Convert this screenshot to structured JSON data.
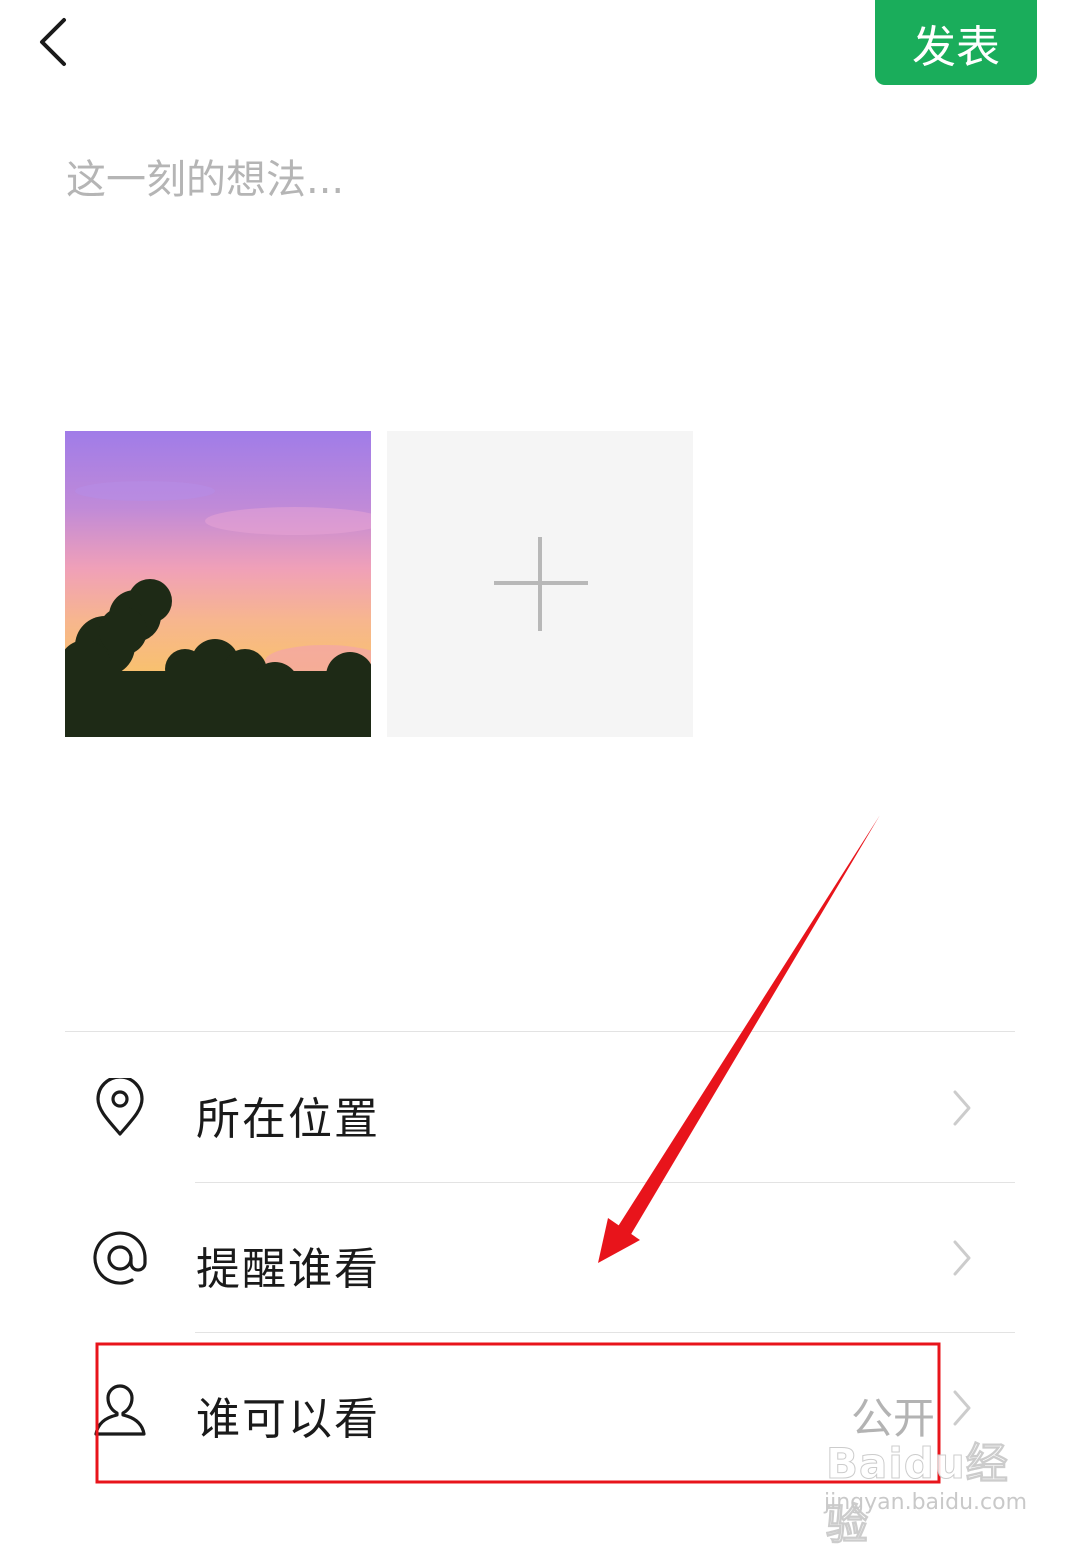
{
  "header": {
    "back_icon": "chevron-left-icon",
    "publish_label": "发表",
    "publish_color": "#1aad5b"
  },
  "composer": {
    "placeholder": "这一刻的想法...",
    "value": ""
  },
  "photos": {
    "add_icon": "plus-icon"
  },
  "options": [
    {
      "icon": "location-pin-icon",
      "label": "所在位置",
      "value": ""
    },
    {
      "icon": "at-sign-icon",
      "label": "提醒谁看",
      "value": ""
    },
    {
      "icon": "person-icon",
      "label": "谁可以看",
      "value": "公开"
    }
  ],
  "annotation": {
    "color": "#e8141b"
  },
  "watermark": {
    "brand": "Baidu经验",
    "url": "jingyan.baidu.com"
  }
}
